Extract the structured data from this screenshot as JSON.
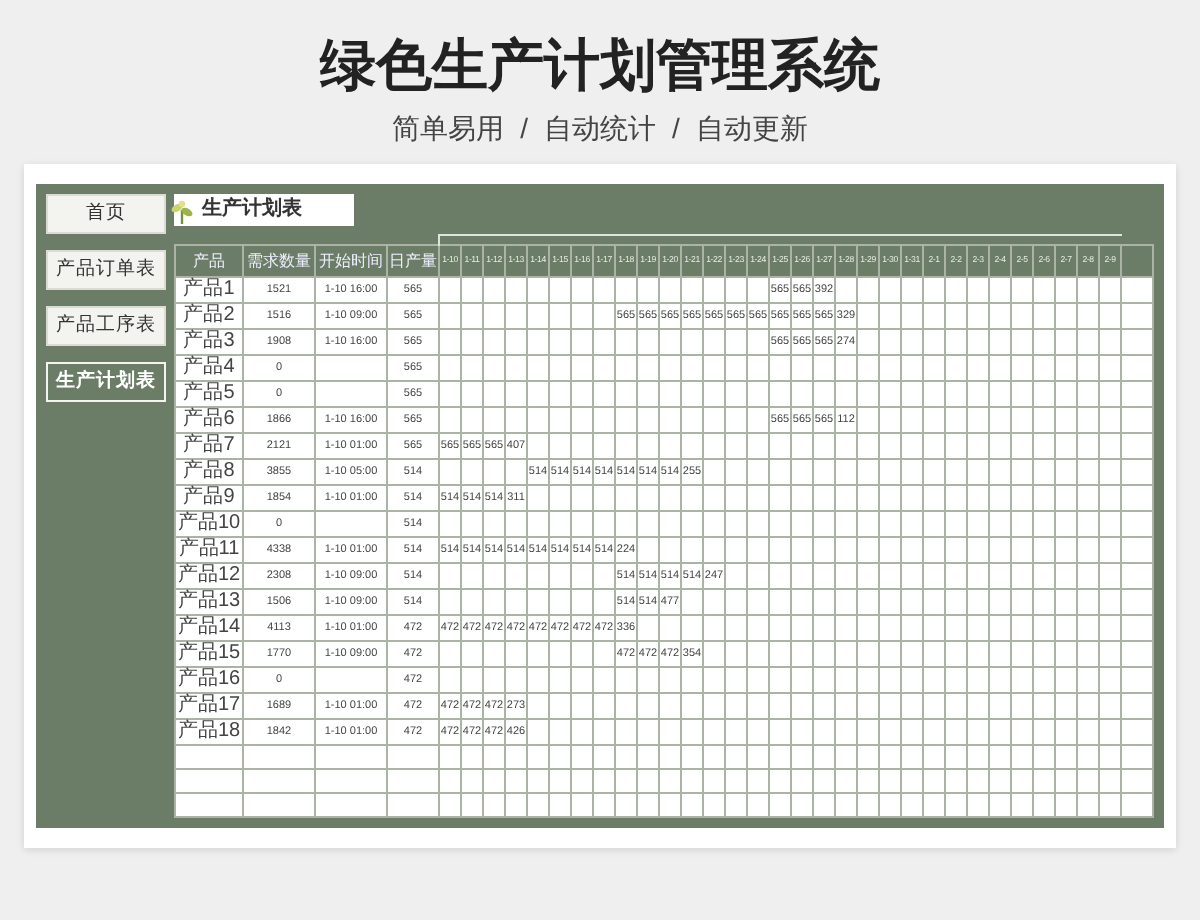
{
  "page": {
    "title": "绿色生产计划管理系统",
    "subtitle": [
      "简单易用",
      "/",
      "自动统计",
      "/",
      "自动更新"
    ]
  },
  "sidebar": {
    "items": [
      {
        "label": "首页",
        "selected": false
      },
      {
        "label": "产品订单表",
        "selected": false
      },
      {
        "label": "产品工序表",
        "selected": false
      },
      {
        "label": "生产计划表",
        "selected": true
      }
    ]
  },
  "sheet_title": "生产计划表",
  "table": {
    "columns": [
      "产品",
      "需求数量",
      "开始时间",
      "日产量"
    ],
    "date_columns": [
      "1-10",
      "1-11",
      "1-12",
      "1-13",
      "1-14",
      "1-15",
      "1-16",
      "1-17",
      "1-18",
      "1-19",
      "1-20",
      "1-21",
      "1-22",
      "1-23",
      "1-24",
      "1-25",
      "1-26",
      "1-27",
      "1-28",
      "1-29",
      "1-30",
      "1-31",
      "2-1",
      "2-2",
      "2-3",
      "2-4",
      "2-5",
      "2-6",
      "2-7",
      "2-8",
      "2-9"
    ],
    "rows": [
      {
        "product": "产品1",
        "quantity": "1521",
        "start": "1-10 16:00",
        "daily": "565",
        "days": [
          {
            "kind": "blank"
          },
          {
            "kind": "blank"
          },
          {
            "kind": "blank"
          },
          {
            "kind": "blank"
          },
          {
            "kind": "blank"
          },
          {
            "kind": "blank"
          },
          {
            "kind": "blank"
          },
          {
            "kind": "blank"
          },
          {
            "kind": "blank"
          },
          {
            "kind": "blank"
          },
          {
            "kind": "blank"
          },
          {
            "kind": "blank"
          },
          {
            "kind": "blank"
          },
          {
            "kind": "blank"
          },
          {
            "kind": "blank"
          },
          {
            "kind": "value",
            "value": "565"
          },
          {
            "kind": "value",
            "value": "565"
          },
          {
            "kind": "value",
            "value": "392"
          }
        ]
      },
      {
        "product": "产品2",
        "quantity": "1516",
        "start": "1-10 09:00",
        "daily": "565",
        "days": [
          {
            "kind": "blank"
          },
          {
            "kind": "blank"
          },
          {
            "kind": "blank"
          },
          {
            "kind": "blank"
          },
          {
            "kind": "blank"
          },
          {
            "kind": "blank"
          },
          {
            "kind": "blank"
          },
          {
            "kind": "blank"
          },
          {
            "kind": "value",
            "value": "565"
          },
          {
            "kind": "value",
            "value": "565"
          },
          {
            "kind": "value",
            "value": "565"
          },
          {
            "kind": "value",
            "value": "565"
          },
          {
            "kind": "value",
            "value": "565"
          },
          {
            "kind": "value",
            "value": "565"
          },
          {
            "kind": "value",
            "value": "565"
          },
          {
            "kind": "value",
            "value": "565"
          },
          {
            "kind": "value",
            "value": "565"
          },
          {
            "kind": "value",
            "value": "565"
          },
          {
            "kind": "value",
            "value": "329"
          }
        ]
      },
      {
        "product": "产品3",
        "quantity": "1908",
        "start": "1-10 16:00",
        "daily": "565",
        "days": [
          {
            "kind": "blank"
          },
          {
            "kind": "blank"
          },
          {
            "kind": "blank"
          },
          {
            "kind": "blank"
          },
          {
            "kind": "blank"
          },
          {
            "kind": "blank"
          },
          {
            "kind": "blank"
          },
          {
            "kind": "blank"
          },
          {
            "kind": "blank"
          },
          {
            "kind": "blank"
          },
          {
            "kind": "blank"
          },
          {
            "kind": "blank"
          },
          {
            "kind": "blank"
          },
          {
            "kind": "blank"
          },
          {
            "kind": "blank"
          },
          {
            "kind": "value",
            "value": "565"
          },
          {
            "kind": "value",
            "value": "565"
          },
          {
            "kind": "value",
            "value": "565"
          },
          {
            "kind": "value",
            "value": "274"
          }
        ]
      },
      {
        "product": "产品4",
        "quantity": "0",
        "daily": "565"
      },
      {
        "product": "产品5",
        "quantity": "0",
        "daily": "565"
      },
      {
        "product": "产品6",
        "quantity": "1866",
        "start": "1-10 16:00",
        "daily": "565",
        "days": [
          {
            "kind": "blank"
          },
          {
            "kind": "blank"
          },
          {
            "kind": "blank"
          },
          {
            "kind": "blank"
          },
          {
            "kind": "blank"
          },
          {
            "kind": "blank"
          },
          {
            "kind": "blank"
          },
          {
            "kind": "blank"
          },
          {
            "kind": "blank"
          },
          {
            "kind": "blank"
          },
          {
            "kind": "blank"
          },
          {
            "kind": "blank"
          },
          {
            "kind": "blank"
          },
          {
            "kind": "blank"
          },
          {
            "kind": "blank"
          },
          {
            "kind": "value",
            "value": "565"
          },
          {
            "kind": "value",
            "value": "565"
          },
          {
            "kind": "value",
            "value": "565"
          },
          {
            "kind": "value",
            "value": "112"
          }
        ]
      },
      {
        "product": "产品7",
        "quantity": "2121",
        "start": "1-10 01:00",
        "daily": "565",
        "days": [
          {
            "kind": "value",
            "value": "565"
          },
          {
            "kind": "value",
            "value": "565"
          },
          {
            "kind": "value",
            "value": "565"
          },
          {
            "kind": "value",
            "value": "407"
          }
        ]
      },
      {
        "product": "产品8",
        "quantity": "3855",
        "start": "1-10 05:00",
        "daily": "514",
        "days": [
          {
            "kind": "blank"
          },
          {
            "kind": "blank"
          },
          {
            "kind": "blank"
          },
          {
            "kind": "blank"
          },
          {
            "kind": "value",
            "value": "514"
          },
          {
            "kind": "value",
            "value": "514"
          },
          {
            "kind": "value",
            "value": "514"
          },
          {
            "kind": "value",
            "value": "514"
          },
          {
            "kind": "value",
            "value": "514"
          },
          {
            "kind": "value",
            "value": "514"
          },
          {
            "kind": "value",
            "value": "514"
          },
          {
            "kind": "value",
            "value": "255"
          }
        ]
      },
      {
        "product": "产品9",
        "quantity": "1854",
        "start": "1-10 01:00",
        "daily": "514",
        "days": [
          {
            "kind": "value",
            "value": "514"
          },
          {
            "kind": "value",
            "value": "514"
          },
          {
            "kind": "value",
            "value": "514"
          },
          {
            "kind": "value",
            "value": "311"
          }
        ]
      },
      {
        "product": "产品10",
        "quantity": "0",
        "daily": "514"
      },
      {
        "product": "产品11",
        "quantity": "4338",
        "start": "1-10 01:00",
        "daily": "514",
        "days": [
          {
            "kind": "value",
            "value": "514"
          },
          {
            "kind": "value",
            "value": "514"
          },
          {
            "kind": "value",
            "value": "514"
          },
          {
            "kind": "value",
            "value": "514"
          },
          {
            "kind": "value",
            "value": "514"
          },
          {
            "kind": "value",
            "value": "514"
          },
          {
            "kind": "value",
            "value": "514"
          },
          {
            "kind": "value",
            "value": "514"
          },
          {
            "kind": "value",
            "value": "224"
          }
        ]
      },
      {
        "product": "产品12",
        "quantity": "2308",
        "start": "1-10 09:00",
        "daily": "514",
        "days": [
          {
            "kind": "blank"
          },
          {
            "kind": "blank"
          },
          {
            "kind": "blank"
          },
          {
            "kind": "blank"
          },
          {
            "kind": "blank"
          },
          {
            "kind": "blank"
          },
          {
            "kind": "blank"
          },
          {
            "kind": "blank"
          },
          {
            "kind": "value",
            "value": "514"
          },
          {
            "kind": "value",
            "value": "514"
          },
          {
            "kind": "value",
            "value": "514"
          },
          {
            "kind": "value",
            "value": "514"
          },
          {
            "kind": "value",
            "value": "247"
          }
        ]
      },
      {
        "product": "产品13",
        "quantity": "1506",
        "start": "1-10 09:00",
        "daily": "514",
        "days": [
          {
            "kind": "blank"
          },
          {
            "kind": "blank"
          },
          {
            "kind": "blank"
          },
          {
            "kind": "blank"
          },
          {
            "kind": "blank"
          },
          {
            "kind": "blank"
          },
          {
            "kind": "blank"
          },
          {
            "kind": "blank"
          },
          {
            "kind": "value",
            "value": "514"
          },
          {
            "kind": "value",
            "value": "514"
          },
          {
            "kind": "value",
            "value": "477"
          }
        ]
      },
      {
        "product": "产品14",
        "quantity": "4113",
        "start": "1-10 01:00",
        "daily": "472",
        "days": [
          {
            "kind": "value",
            "value": "472"
          },
          {
            "kind": "value",
            "value": "472"
          },
          {
            "kind": "value",
            "value": "472"
          },
          {
            "kind": "value",
            "value": "472"
          },
          {
            "kind": "value",
            "value": "472"
          },
          {
            "kind": "value",
            "value": "472"
          },
          {
            "kind": "value",
            "value": "472"
          },
          {
            "kind": "value",
            "value": "472"
          },
          {
            "kind": "value",
            "value": "336"
          }
        ]
      },
      {
        "product": "产品15",
        "quantity": "1770",
        "start": "1-10 09:00",
        "daily": "472",
        "days": [
          {
            "kind": "blank"
          },
          {
            "kind": "blank"
          },
          {
            "kind": "blank"
          },
          {
            "kind": "blank"
          },
          {
            "kind": "blank"
          },
          {
            "kind": "blank"
          },
          {
            "kind": "blank"
          },
          {
            "kind": "blank"
          },
          {
            "kind": "value",
            "value": "472"
          },
          {
            "kind": "value",
            "value": "472"
          },
          {
            "kind": "value",
            "value": "472"
          },
          {
            "kind": "value",
            "value": "354"
          }
        ]
      },
      {
        "product": "产品16",
        "quantity": "0",
        "daily": "472"
      },
      {
        "product": "产品17",
        "quantity": "1689",
        "start": "1-10 01:00",
        "daily": "472",
        "days": [
          {
            "kind": "value",
            "value": "472"
          },
          {
            "kind": "value",
            "value": "472"
          },
          {
            "kind": "value",
            "value": "472"
          },
          {
            "kind": "value",
            "value": "273"
          }
        ]
      },
      {
        "product": "产品18",
        "quantity": "1842",
        "start": "1-10 01:00",
        "daily": "472",
        "days": [
          {
            "kind": "value",
            "value": "472"
          },
          {
            "kind": "value",
            "value": "472"
          },
          {
            "kind": "value",
            "value": "472"
          },
          {
            "kind": "value",
            "value": "426"
          }
        ]
      }
    ]
  }
}
